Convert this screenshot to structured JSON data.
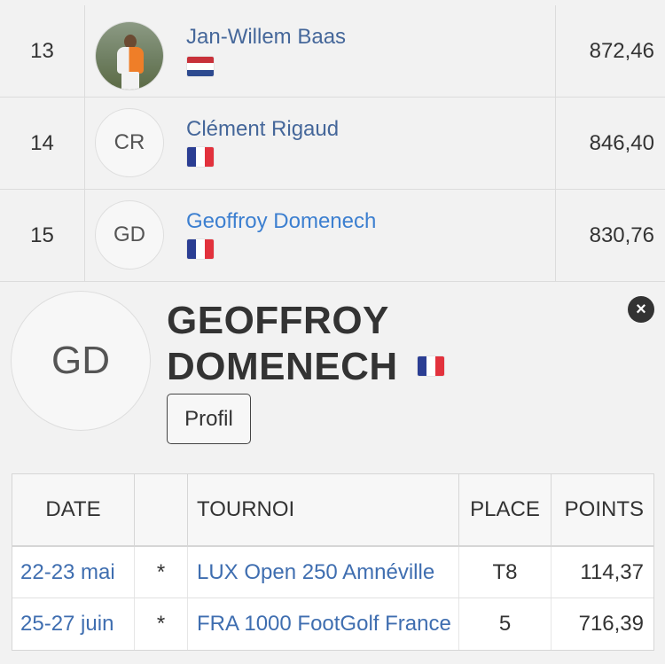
{
  "ranking": [
    {
      "rank": "13",
      "name": "Jan-Willem Baas",
      "initials": "",
      "avatar": "photo",
      "flag": "nl",
      "points": "872,46"
    },
    {
      "rank": "14",
      "name": "Clément Rigaud",
      "initials": "CR",
      "avatar": "initials",
      "flag": "fr",
      "points": "846,40"
    },
    {
      "rank": "15",
      "name": "Geoffroy Domenech",
      "initials": "GD",
      "avatar": "initials",
      "flag": "fr",
      "points": "830,76"
    }
  ],
  "detail": {
    "initials": "GD",
    "name_line1": "GEOFFROY",
    "name_line2": "DOMENECH",
    "flag": "fr",
    "close_icon": "×",
    "profile_button": "Profil"
  },
  "results": {
    "headers": {
      "date": "DATE",
      "star": "",
      "tournament": "TOURNOI",
      "place": "PLACE",
      "points": "POINTS"
    },
    "rows": [
      {
        "date": "22-23 mai",
        "star": "*",
        "tournament": "LUX Open 250 Amnéville",
        "place": "T8",
        "points": "114,37"
      },
      {
        "date": "25-27 juin",
        "star": "*",
        "tournament": "FRA 1000 FootGolf France",
        "place": "5",
        "points": "716,39"
      }
    ]
  },
  "colors": {
    "background": "#f2f2f2",
    "link": "#45679a",
    "link_active": "#3c7fd0",
    "text": "#333333",
    "flag_fr": [
      "#2b3e93",
      "#ffffff",
      "#e2323d"
    ],
    "flag_nl": [
      "#c8313a",
      "#ffffff",
      "#2d4a8f"
    ]
  },
  "icons": {
    "close": "close-icon",
    "flag_fr": "france-flag-icon",
    "flag_nl": "netherlands-flag-icon"
  }
}
